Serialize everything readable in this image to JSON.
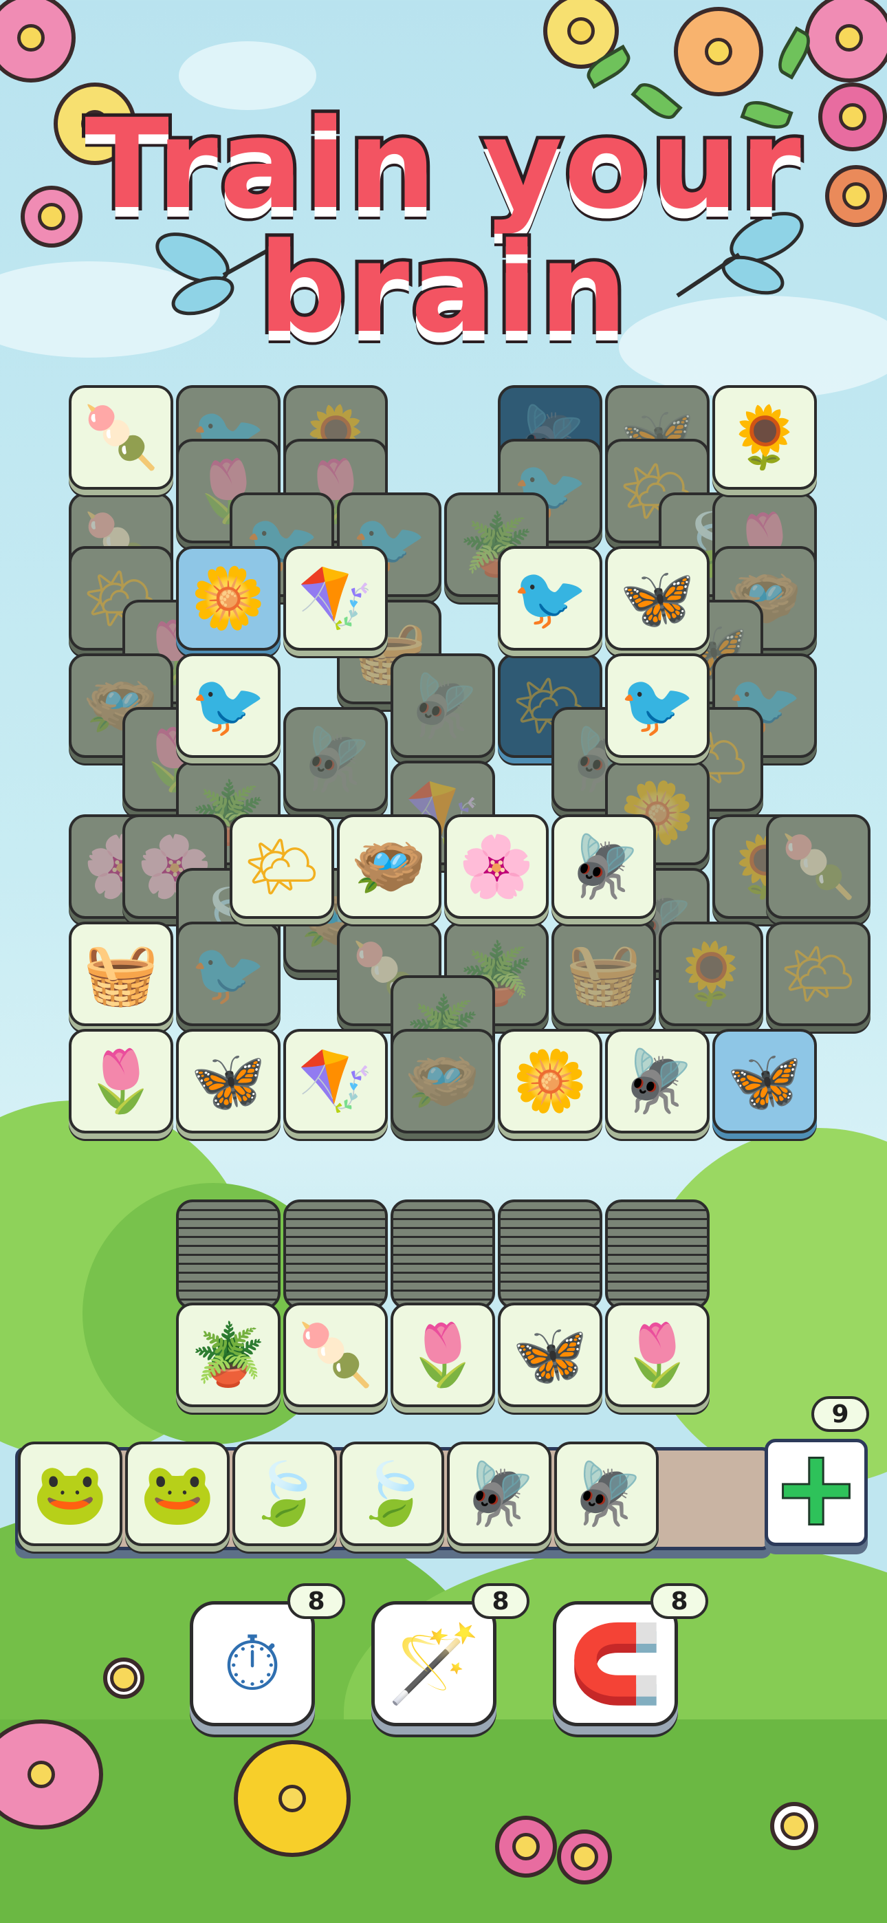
{
  "title": {
    "line1": "Train your",
    "line2": "brain"
  },
  "colors": {
    "title_fill": "#f35462",
    "tile_face": "#eef8e0",
    "tile_dim": "#7d8979",
    "tile_selected": "#8ec6e6",
    "add_button": "#2ec25a",
    "tray": "#c9b4a3"
  },
  "icons": {
    "popsicle": "🍡",
    "bird": "🐦",
    "tulips": "🌷",
    "flowerpot": "🪴",
    "sun": "🌤",
    "kite": "🪁",
    "butterfly": "🦋",
    "dragonfly": "🪰",
    "leaf": "🍃",
    "basket": "🧺",
    "daisy": "🌼",
    "branch": "🌸",
    "nest": "🪺",
    "shovel": "🌻",
    "frog": "🐸"
  },
  "board": {
    "open_tiles": [
      "popsicle",
      "shovel",
      "daisy",
      "kite",
      "bird",
      "butterfly",
      "bird",
      "bird",
      "sun",
      "nest",
      "branch",
      "dragonfly",
      "basket",
      "tulips",
      "butterfly",
      "kite",
      "daisy",
      "dragonfly",
      "butterfly"
    ]
  },
  "stacks": {
    "tops": [
      "flowerpot",
      "popsicle",
      "tulips",
      "butterfly",
      "tulips"
    ]
  },
  "tray": {
    "tiles": [
      "frog",
      "frog",
      "leaf",
      "leaf",
      "dragonfly",
      "dragonfly"
    ],
    "add_button_label": "+",
    "add_count": "9"
  },
  "boosters": [
    {
      "name": "clock",
      "icon": "⏱",
      "count": "8"
    },
    {
      "name": "wand",
      "icon": "🪄",
      "count": "8"
    },
    {
      "name": "magnet",
      "icon": "🧲",
      "count": "8"
    }
  ]
}
